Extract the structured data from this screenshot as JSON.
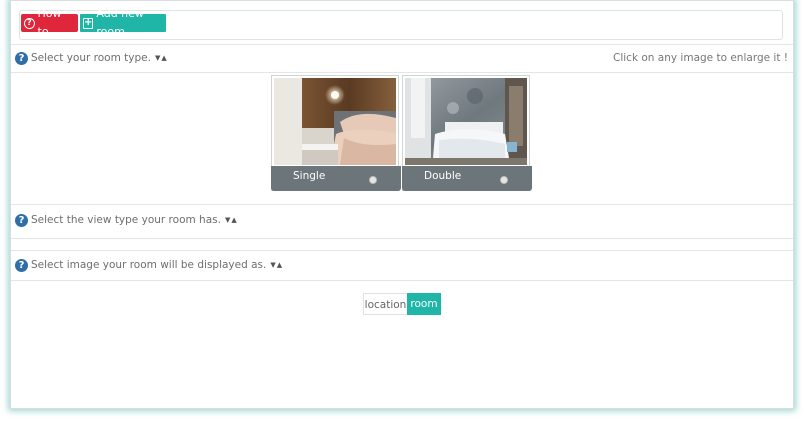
{
  "toolbar": {
    "howto_label": "How to",
    "add_room_label": "Add new room"
  },
  "sections": {
    "room_type": {
      "title": "Select your room type.",
      "hint": "Click on any image to enlarge it !"
    },
    "view_type": {
      "title": "Select the view type your room has."
    },
    "display_image": {
      "title": "Select image your room will be displayed as."
    }
  },
  "rooms": [
    {
      "label": "Single",
      "selected": false
    },
    {
      "label": "Double",
      "selected": false
    }
  ],
  "display_toggle": {
    "options": [
      "location",
      "room"
    ],
    "selected": "room"
  },
  "colors": {
    "danger": "#e0263a",
    "accent": "#1fb5a7",
    "help_icon": "#2f6ea6",
    "label_bar": "#6c757a"
  }
}
